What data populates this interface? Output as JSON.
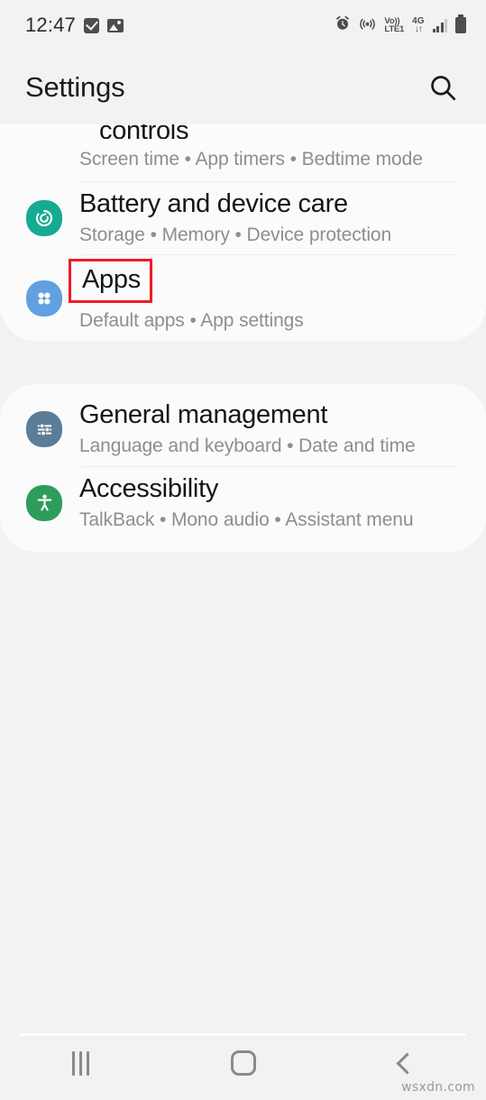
{
  "status_bar": {
    "time": "12:47",
    "left_icons": [
      {
        "name": "checkbox-badge-icon",
        "label": "checkbox"
      },
      {
        "name": "image-badge-icon",
        "label": "image"
      }
    ],
    "right_icons": [
      {
        "name": "alarm-icon",
        "label": "alarm"
      },
      {
        "name": "hotspot-icon",
        "label": "hotspot"
      },
      {
        "name": "volte-icon",
        "label_top": "Vo))",
        "label_bottom": "LTE1"
      },
      {
        "name": "network-4g-icon",
        "label_top": "4G",
        "label_bottom": "↓↑"
      },
      {
        "name": "signal-bars-icon",
        "label": "signal"
      },
      {
        "name": "battery-icon",
        "label": "battery"
      }
    ]
  },
  "app_bar": {
    "title": "Settings",
    "search_icon": "search-icon"
  },
  "cards": [
    {
      "id": "card-first",
      "truncated_top_text": "controls",
      "items": [
        {
          "id": "digital-wellbeing",
          "title": "",
          "subtitle": "Screen time  •  App timers  •  Bedtime mode",
          "icon": null,
          "highlighted": false,
          "truncated": true
        },
        {
          "id": "battery-and-device-care",
          "title": "Battery and device care",
          "subtitle": "Storage  •  Memory  •  Device protection",
          "icon": "battery-care-icon",
          "icon_color": "#14ab92",
          "highlighted": false
        },
        {
          "id": "apps",
          "title": "Apps",
          "subtitle": "Default apps  •  App settings",
          "icon": "apps-grid-icon",
          "icon_color": "#62a0e2",
          "highlighted": true,
          "highlight_color": "#ee1c24"
        }
      ]
    },
    {
      "id": "card-second",
      "items": [
        {
          "id": "general-management",
          "title": "General management",
          "subtitle": "Language and keyboard  •  Date and time",
          "icon": "sliders-icon",
          "icon_color": "#5b7d98",
          "highlighted": false
        },
        {
          "id": "accessibility",
          "title": "Accessibility",
          "subtitle": "TalkBack  •  Mono audio  •  Assistant menu",
          "icon": "accessibility-person-icon",
          "icon_color": "#2e9d5c",
          "highlighted": false
        }
      ]
    }
  ],
  "nav_bar": {
    "recents_label": "recents-icon",
    "home_label": "home-icon",
    "back_label": "back-icon"
  },
  "watermark": "wsxdn.com"
}
